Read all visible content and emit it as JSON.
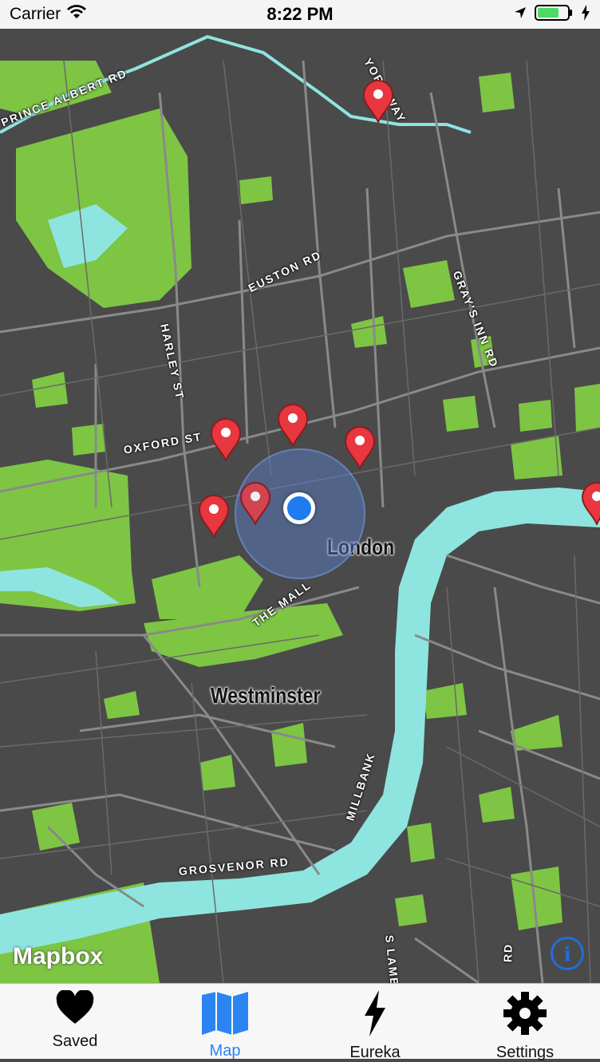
{
  "status_bar": {
    "carrier": "Carrier",
    "time": "8:22 PM"
  },
  "map": {
    "road_labels": {
      "prince_albert": "PRINCE ALBERT RD",
      "york_way": "YORK WAY",
      "euston": "EUSTON RD",
      "grays_inn": "GRAY'S INN RD",
      "harley": "HARLEY ST",
      "oxford": "OXFORD ST",
      "mall": "THE MALL",
      "millbank": "MILLBANK",
      "grosvenor": "GROSVENOR RD",
      "s_lambeth": "S LAMB",
      "rd_right": "RD"
    },
    "city_labels": {
      "london": "London",
      "westminster": "Westminster"
    },
    "attribution": "Mapbox",
    "info_symbol": "i",
    "colors": {
      "land": "#4a4a4a",
      "parks": "#7ec544",
      "water": "#8ee5e0",
      "roads": "#9a9a9a",
      "pin": "#e8373f",
      "user_location": "#1e7cf0"
    }
  },
  "tabbar": {
    "tabs": [
      {
        "label": "Saved",
        "icon": "heart-icon"
      },
      {
        "label": "Map",
        "icon": "map-icon",
        "active": true
      },
      {
        "label": "Eureka",
        "icon": "lightning-icon"
      },
      {
        "label": "Settings",
        "icon": "gear-icon"
      }
    ]
  }
}
